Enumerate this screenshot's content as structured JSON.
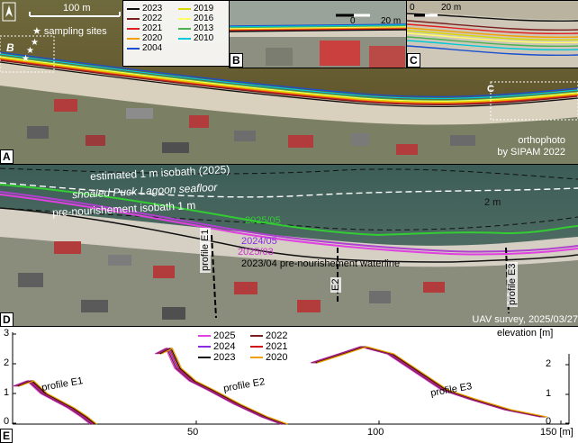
{
  "panel_a": {
    "letter": "A",
    "scale_label": "100 m",
    "sampling_label": "★ sampling sites",
    "letter_b_marker": "B",
    "letter_c_marker": "C",
    "orthophoto_line1": "orthophoto",
    "orthophoto_line2": "by SIPAM 2022",
    "legend": [
      {
        "year": "2023",
        "color": "#111111"
      },
      {
        "year": "2019",
        "color": "#d8d800"
      },
      {
        "year": "2022",
        "color": "#7a1f1f"
      },
      {
        "year": "2016",
        "color": "#ffff66"
      },
      {
        "year": "2021",
        "color": "#e02020"
      },
      {
        "year": "2013",
        "color": "#4caf50"
      },
      {
        "year": "2020",
        "color": "#f0a000"
      },
      {
        "year": "2010",
        "color": "#00c8d8"
      },
      {
        "year": "2004",
        "color": "#1a4fd0"
      }
    ]
  },
  "panel_b": {
    "letter": "B",
    "scale_zero": "0",
    "scale_label": "20 m"
  },
  "panel_c": {
    "letter": "C",
    "scale_zero": "0",
    "scale_label": "20 m"
  },
  "panel_d": {
    "letter": "D",
    "isobath_2025": "estimated 1 m isobath (2025)",
    "two_m": "2 m",
    "shoaled": "shoaled Puck Lagoon seafloor",
    "pre_isobath": "pre-nourishement isobath 1 m",
    "wl_2025_05": "2025/05",
    "wl_2024_05": "2024/05",
    "wl_2025_03": "2025/03",
    "pre_waterline": "2023/04 pre-nourishement waterline",
    "profile_e1": "profile E1",
    "profile_e2": "E2",
    "profile_e3": "profile E3",
    "uav": "UAV survey, 2025/03/27"
  },
  "panel_e": {
    "letter": "E",
    "y_ticks_left": [
      "3",
      "2",
      "1",
      "0"
    ],
    "y_ticks_right": [
      "2",
      "1",
      "0"
    ],
    "x_ticks": [
      "50",
      "100",
      "150 [m]"
    ],
    "elevation_label": "elevation [m]",
    "profile_e1": "profile E1",
    "profile_e2": "profile E2",
    "profile_e3": "profile E3",
    "legend": [
      {
        "year": "2025",
        "color": "#e040e0"
      },
      {
        "year": "2022",
        "color": "#7a1f1f"
      },
      {
        "year": "2024",
        "color": "#8a2be2"
      },
      {
        "year": "2021",
        "color": "#d01010"
      },
      {
        "year": "2023",
        "color": "#111111"
      },
      {
        "year": "2020",
        "color": "#f0a000"
      }
    ]
  },
  "colors": {
    "beach": "#cfc7b4",
    "water_a": "#6a5b2c",
    "water_d": "#3f5e57",
    "magenta": "#cc33cc",
    "green": "#33cc33"
  }
}
